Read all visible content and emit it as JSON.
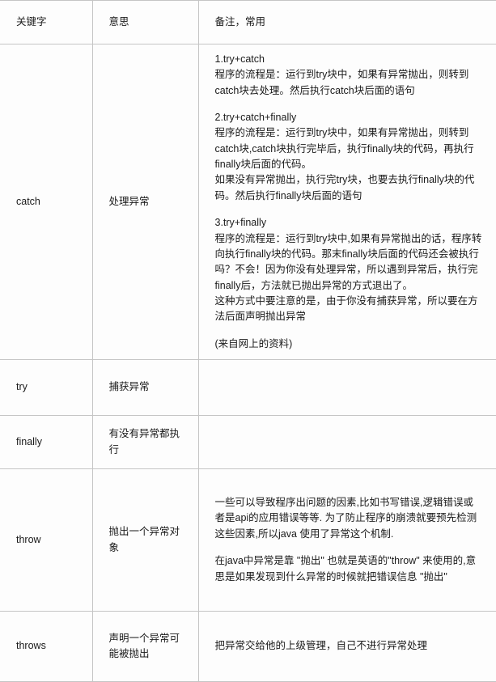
{
  "table": {
    "headers": {
      "keyword": "关键字",
      "meaning": "意思",
      "remark": "备注，常用"
    },
    "rows": [
      {
        "keyword": "catch",
        "meaning": "处理异常",
        "remark_paragraphs": [
          "1.try+catch\n程序的流程是：运行到try块中，如果有异常抛出，则转到catch块去处理。然后执行catch块后面的语句",
          "2.try+catch+finally\n程序的流程是：运行到try块中，如果有异常抛出，则转到catch块,catch块执行完毕后，执行finally块的代码，再执行finally块后面的代码。\n如果没有异常抛出，执行完try块，也要去执行finally块的代码。然后执行finally块后面的语句",
          "3.try+finally\n程序的流程是：运行到try块中,如果有异常抛出的话，程序转向执行finally块的代码。那末finally块后面的代码还会被执行吗？不会！因为你没有处理异常，所以遇到异常后，执行完finally后，方法就已抛出异常的方式退出了。\n这种方式中要注意的是，由于你没有捕获异常，所以要在方法后面声明抛出异常",
          "(来自网上的资料)"
        ]
      },
      {
        "keyword": "try",
        "meaning": "捕获异常",
        "remark_paragraphs": []
      },
      {
        "keyword": "finally",
        "meaning": "有没有异常都执行",
        "remark_paragraphs": []
      },
      {
        "keyword": "throw",
        "meaning": "抛出一个异常对象",
        "remark_paragraphs": [
          "一些可以导致程序出问题的因素,比如书写错误,逻辑错误或者是api的应用错误等等. 为了防止程序的崩溃就要预先检测这些因素,所以java 使用了异常这个机制.",
          "在java中异常是靠 \"抛出\" 也就是英语的\"throw\" 来使用的,意思是如果发现到什么异常的时候就把错误信息 \"抛出\""
        ]
      },
      {
        "keyword": "throws",
        "meaning": "声明一个异常可能被抛出",
        "remark_paragraphs": [
          "把异常交给他的上级管理，自己不进行异常处理"
        ]
      }
    ]
  }
}
